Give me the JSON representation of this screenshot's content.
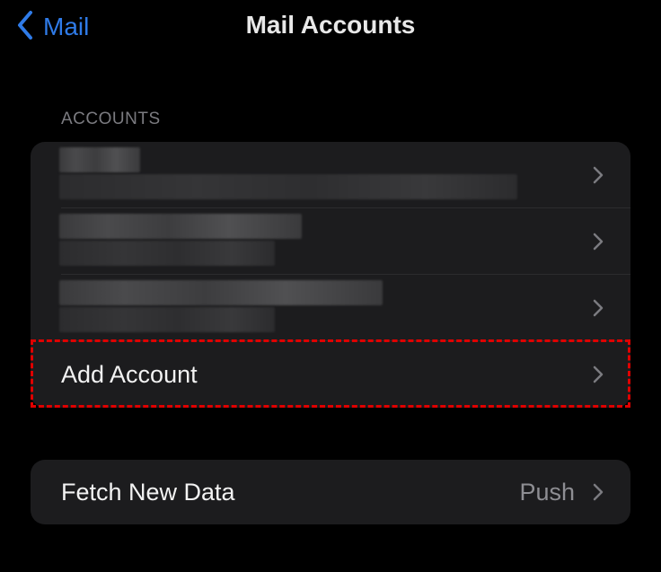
{
  "nav": {
    "back_label": "Mail",
    "title": "Mail Accounts"
  },
  "accounts_section": {
    "header": "ACCOUNTS",
    "add_account_label": "Add Account"
  },
  "fetch": {
    "label": "Fetch New Data",
    "value": "Push"
  },
  "colors": {
    "accent": "#2f7be8",
    "highlight": "#e00000",
    "group_background": "#1c1c1e"
  },
  "icons": {
    "back": "chevron-left-icon",
    "disclosure": "chevron-right-icon"
  }
}
